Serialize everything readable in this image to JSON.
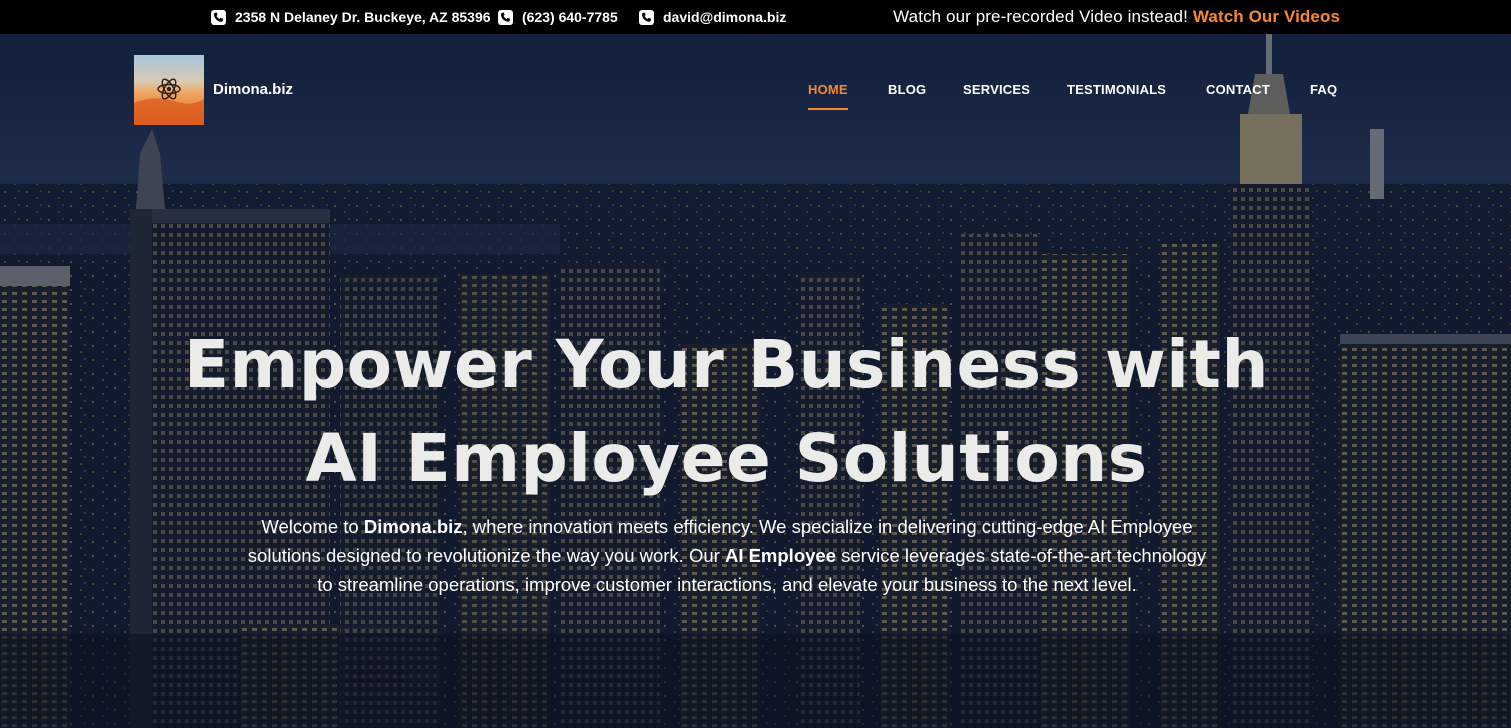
{
  "topbar": {
    "address": "2358 N Delaney Dr. Buckeye, AZ 85396",
    "phone": "(623) 640-7785",
    "email": "david@dimona.biz",
    "video_prompt": "Watch our pre-recorded Video instead!",
    "video_link": "Watch Our Videos",
    "icons": [
      "phone-icon",
      "phone-icon",
      "phone-icon"
    ]
  },
  "header": {
    "brand": "Dimona.biz",
    "nav": [
      {
        "label": "HOME",
        "active": true
      },
      {
        "label": "BLOG",
        "active": false
      },
      {
        "label": "SERVICES",
        "active": false
      },
      {
        "label": "TESTIMONIALS",
        "active": false
      },
      {
        "label": "CONTACT",
        "active": false
      },
      {
        "label": "FAQ",
        "active": false
      }
    ]
  },
  "hero": {
    "headline_line1": "Empower Your Business with",
    "headline_line2": "AI Employee Solutions",
    "intro_1": "Welcome to ",
    "intro_brand": "Dimona.biz",
    "intro_2": ", where innovation meets efficiency. We specialize in delivering cutting-edge AI Employee solutions designed to revolutionize the way you work. Our ",
    "intro_service": "AI Employee",
    "intro_3": " service leverages state-of-the-art technology to streamline operations, improve customer interactions, and elevate your business to the next level."
  },
  "colors": {
    "accent": "#f7882f",
    "topbar_bg": "#000000",
    "headline": "#ebebea"
  }
}
